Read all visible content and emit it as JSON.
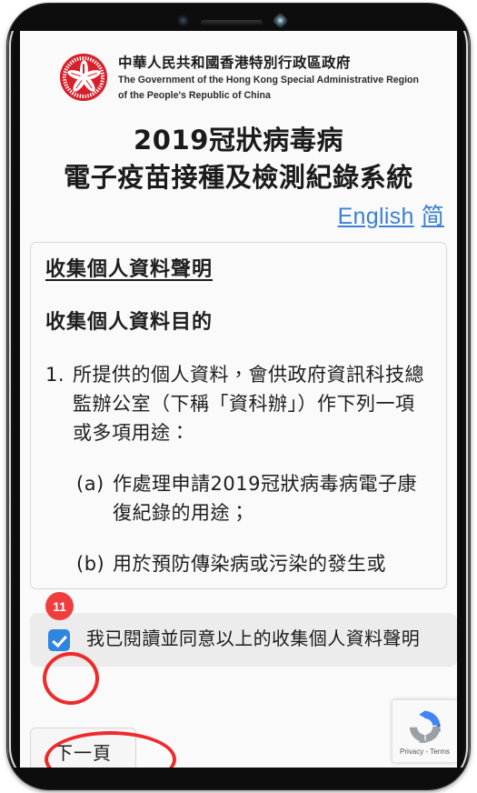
{
  "device": {
    "camera_icon": "camera-icon",
    "speaker_icon": "speaker-grille-icon",
    "sensor_icon": "proximity-sensor-icon"
  },
  "gov_header": {
    "emblem_name": "hong-kong-sar-emblem",
    "chinese": "中華人民共和國香港特別行政區政府",
    "english_line1": "The Government of the Hong Kong Special Administrative Region",
    "english_line2": "of the People's Republic of China"
  },
  "title": {
    "line1": "2019冠狀病毒病",
    "line2": "電子疫苗接種及檢測紀錄系統"
  },
  "language": {
    "english": "English",
    "simplified": "简"
  },
  "statement": {
    "heading_main": "收集個人資料聲明",
    "heading_sub": "收集個人資料目的",
    "items": [
      {
        "num": "1.",
        "text": "所提供的個人資料，會供政府資訊科技總監辦公室（下稱「資科辦」）作下列一項或多項用途："
      }
    ],
    "sub_items": [
      {
        "label": "(a)",
        "text": "作處理申請2019冠狀病毒病電子康復紀錄的用途；"
      },
      {
        "label": "(b)",
        "text": "用於預防傳染病或污染的發生或"
      }
    ]
  },
  "marker": {
    "number": "11"
  },
  "consent": {
    "checked": true,
    "label": "我已閱讀並同意以上的收集個人資料聲明"
  },
  "actions": {
    "next_label": "下一頁"
  },
  "recaptcha": {
    "logo_name": "recaptcha-logo-icon",
    "footer": "Privacy - Terms"
  },
  "colors": {
    "link": "#3d7fd4",
    "emblem_red": "#d81f2a",
    "marker_red": "#f03e3e",
    "annotation_red": "#ee2a2a",
    "checkbox_blue": "#2e86de",
    "panel_gray": "#ececec"
  }
}
